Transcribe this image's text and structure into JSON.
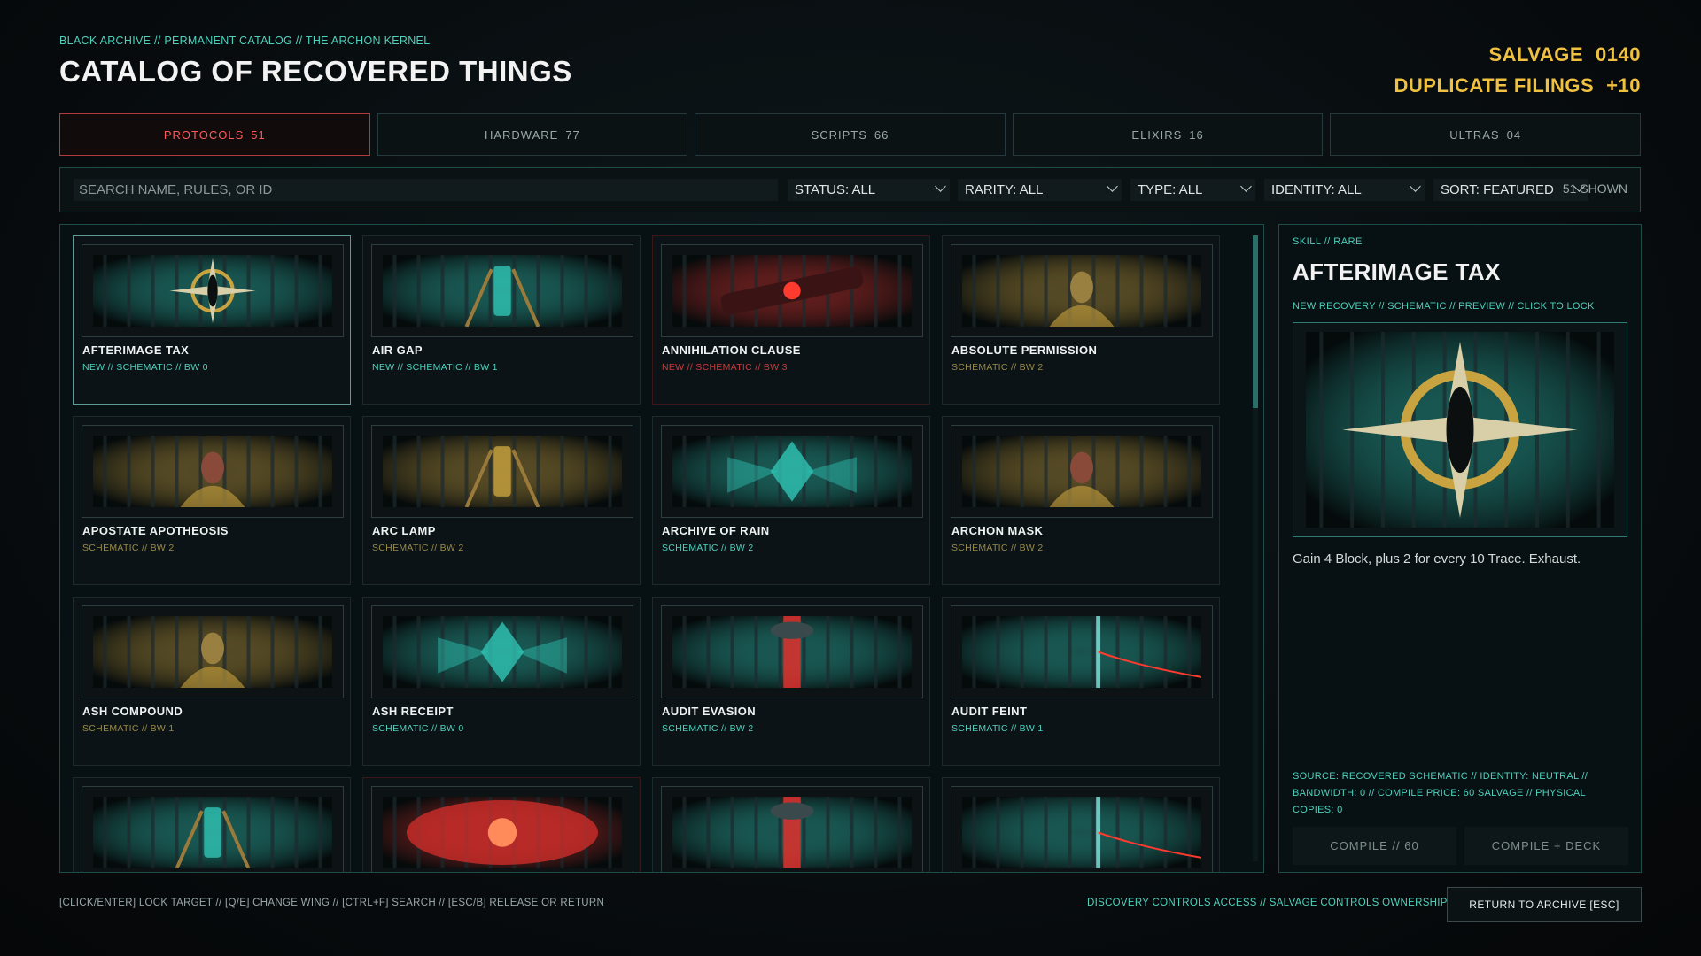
{
  "header": {
    "breadcrumb": "BLACK ARCHIVE // PERMANENT CATALOG // THE ARCHON KERNEL",
    "title": "CATALOG OF RECOVERED THINGS",
    "salvage_label": "SALVAGE",
    "salvage_value": "0140",
    "filings_label": "DUPLICATE FILINGS",
    "filings_value": "+10"
  },
  "tabs": [
    {
      "label": "PROTOCOLS",
      "count": "51",
      "active": true
    },
    {
      "label": "HARDWARE",
      "count": "77",
      "active": false
    },
    {
      "label": "SCRIPTS",
      "count": "66",
      "active": false
    },
    {
      "label": "ELIXIRS",
      "count": "16",
      "active": false
    },
    {
      "label": "ULTRAS",
      "count": "04",
      "active": false
    }
  ],
  "filters": {
    "search_placeholder": "SEARCH NAME, RULES, OR ID",
    "status": "STATUS: ALL",
    "rarity": "RARITY: ALL",
    "type": "TYPE: ALL",
    "identity": "IDENTITY: ALL",
    "sort": "SORT: FEATURED",
    "shown": "51 SHOWN"
  },
  "cards": [
    {
      "name": "AFTERIMAGE TAX",
      "meta": "NEW // SCHEMATIC // BW 0",
      "tone": "teal",
      "art": "cross",
      "selected": true
    },
    {
      "name": "AIR GAP",
      "meta": "NEW // SCHEMATIC // BW 1",
      "tone": "teal",
      "art": "machine"
    },
    {
      "name": "ANNIHILATION CLAUSE",
      "meta": "NEW // SCHEMATIC // BW 3",
      "tone": "red",
      "art": "cannon"
    },
    {
      "name": "ABSOLUTE PERMISSION",
      "meta": "SCHEMATIC // BW 2",
      "tone": "gold",
      "art": "throne"
    },
    {
      "name": "APOSTATE APOTHEOSIS",
      "meta": "SCHEMATIC // BW 2",
      "tone": "gold",
      "art": "figure"
    },
    {
      "name": "ARC LAMP",
      "meta": "SCHEMATIC // BW 2",
      "tone": "gold",
      "art": "lamp"
    },
    {
      "name": "ARCHIVE OF RAIN",
      "meta": "SCHEMATIC // BW 2",
      "tone": "teal",
      "art": "crystal"
    },
    {
      "name": "ARCHON MASK",
      "meta": "SCHEMATIC // BW 2",
      "tone": "gold",
      "art": "figure"
    },
    {
      "name": "ASH COMPOUND",
      "meta": "SCHEMATIC // BW 1",
      "tone": "gold",
      "art": "skull"
    },
    {
      "name": "ASH RECEIPT",
      "meta": "SCHEMATIC // BW 0",
      "tone": "teal",
      "art": "wings"
    },
    {
      "name": "AUDIT EVASION",
      "meta": "SCHEMATIC // BW 2",
      "tone": "teal",
      "art": "beam"
    },
    {
      "name": "AUDIT FEINT",
      "meta": "SCHEMATIC // BW 1",
      "tone": "teal",
      "art": "laser"
    },
    {
      "name": "",
      "meta": "",
      "tone": "teal",
      "art": "machine"
    },
    {
      "name": "",
      "meta": "",
      "tone": "red",
      "art": "fire"
    },
    {
      "name": "",
      "meta": "",
      "tone": "teal",
      "art": "beam"
    },
    {
      "name": "",
      "meta": "",
      "tone": "teal",
      "art": "laser"
    }
  ],
  "detail": {
    "kicker": "SKILL // RARE",
    "title": "AFTERIMAGE TAX",
    "status": "NEW RECOVERY // SCHEMATIC // PREVIEW // CLICK TO LOCK",
    "description": "Gain 4 Block, plus 2 for every 10 Trace. Exhaust.",
    "facts_line1": "SOURCE: RECOVERED SCHEMATIC  //  IDENTITY: NEUTRAL  //",
    "facts_line2": "BANDWIDTH: 0  //  COMPILE PRICE: 60 SALVAGE  //  PHYSICAL",
    "facts_line3": "COPIES: 0",
    "compile_label": "COMPILE // 60",
    "compile_deck_label": "COMPILE + DECK"
  },
  "footer": {
    "hints": "[CLICK/ENTER] LOCK TARGET  //  [Q/E] CHANGE WING  //  [CTRL+F] SEARCH  //  [ESC/B] RELEASE OR RETURN",
    "policy": "DISCOVERY CONTROLS ACCESS // SALVAGE CONTROLS OWNERSHIP",
    "return_label": "RETURN TO ARCHIVE [ESC]"
  },
  "colors": {
    "accent_teal": "#4fd1bd",
    "accent_gold": "#f0c040",
    "accent_red": "#ff5a5a",
    "panel_border": "#1f4b48"
  }
}
